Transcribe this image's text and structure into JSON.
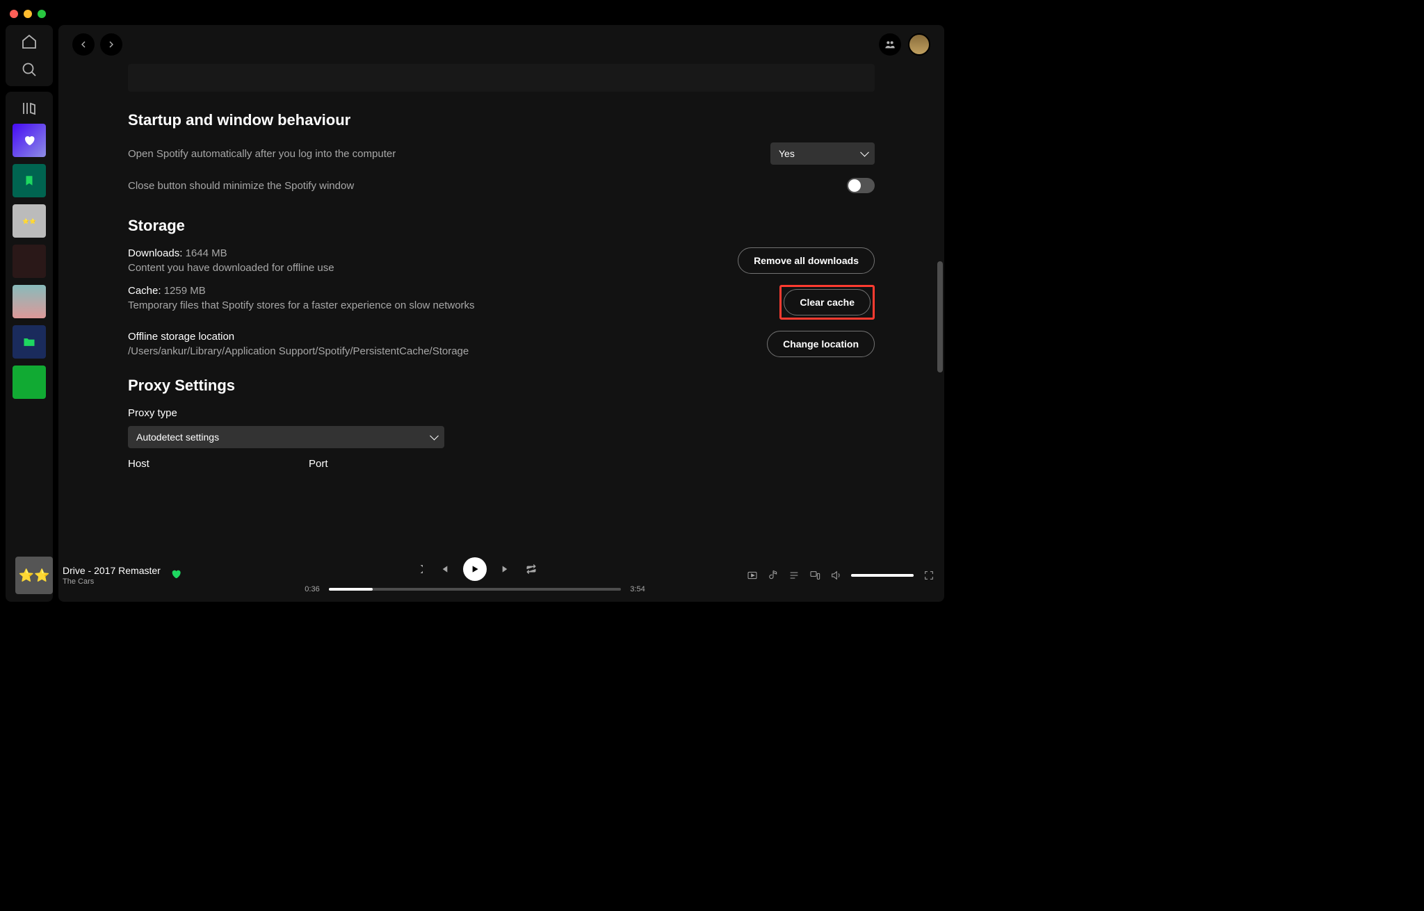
{
  "settings": {
    "section_startup": "Startup and window behaviour",
    "startup_auto_label": "Open Spotify automatically after you log into the computer",
    "startup_select_value": "Yes",
    "close_minimize_label": "Close button should minimize the Spotify window",
    "section_storage": "Storage",
    "downloads_label": "Downloads:",
    "downloads_value": "1644 MB",
    "downloads_desc": "Content you have downloaded for offline use",
    "remove_downloads_btn": "Remove all downloads",
    "cache_label": "Cache:",
    "cache_value": "1259 MB",
    "cache_desc": "Temporary files that Spotify stores for a faster experience on slow networks",
    "clear_cache_btn": "Clear cache",
    "offline_label": "Offline storage location",
    "offline_path": "/Users/ankur/Library/Application Support/Spotify/PersistentCache/Storage",
    "change_location_btn": "Change location",
    "section_proxy": "Proxy Settings",
    "proxy_type_label": "Proxy type",
    "proxy_select_value": "Autodetect settings",
    "host_label": "Host",
    "port_label": "Port"
  },
  "player": {
    "track_title": "Drive - 2017 Remaster",
    "artist": "The Cars",
    "current_time": "0:36",
    "total_time": "3:54"
  }
}
